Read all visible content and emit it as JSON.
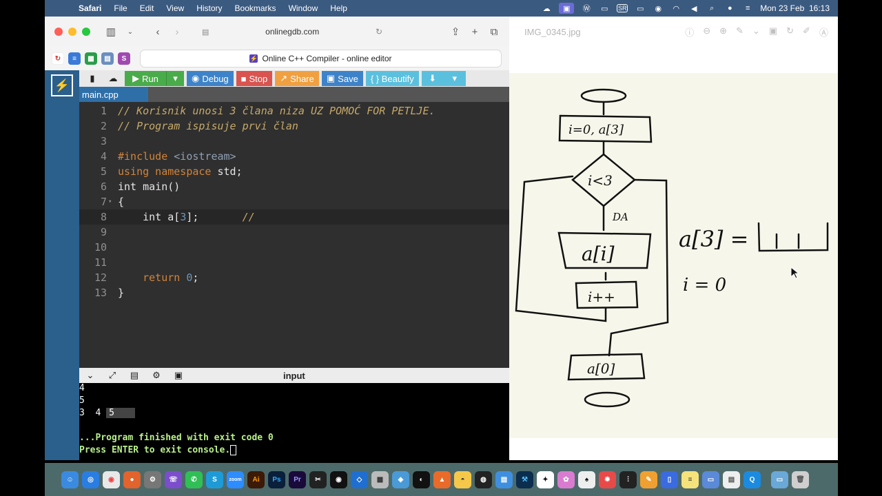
{
  "menubar": {
    "app": "Safari",
    "items": [
      "File",
      "Edit",
      "View",
      "History",
      "Bookmarks",
      "Window",
      "Help"
    ],
    "sr": "SR",
    "clock": "Mon 23 Feb  16:13"
  },
  "safari": {
    "url": "onlinegdb.com",
    "tab_title": "Online C++ Compiler - online editor"
  },
  "toolbar": {
    "run": "Run",
    "debug": "Debug",
    "stop": "Stop",
    "share": "Share",
    "save": "Save",
    "beautify": "{ } Beautify"
  },
  "file_tab": "main.cpp",
  "code_lines": [
    {
      "n": "1",
      "text": "// Korisnik unosi 3 člana niza UZ POMOĆ FOR PETLJE."
    },
    {
      "n": "2",
      "text": "// Program ispisuje prvi član"
    },
    {
      "n": "3",
      "text": ""
    },
    {
      "n": "4",
      "pre": "#include ",
      "inc": "<iostream>"
    },
    {
      "n": "5",
      "kw": "using namespace ",
      "text": "std;"
    },
    {
      "n": "6",
      "text": "int main()"
    },
    {
      "n": "7",
      "text": "{"
    },
    {
      "n": "8",
      "text": "    int a[",
      "num": "3",
      "text2": "];       ",
      "comment": "//"
    },
    {
      "n": "9",
      "text": ""
    },
    {
      "n": "10",
      "text": ""
    },
    {
      "n": "11",
      "text": ""
    },
    {
      "n": "12",
      "kw": "    return ",
      "num": "0",
      "text": ";"
    },
    {
      "n": "13",
      "text": "}"
    }
  ],
  "console": {
    "label": "input",
    "lines": [
      "4",
      "5",
      "3  4 ",
      "5",
      "...Program finished with exit code 0",
      "Press ENTER to exit console."
    ]
  },
  "viewer": {
    "filename": "IMG_0345.jpg",
    "sketch": {
      "init": "i=0, a[3]",
      "cond": "i<3",
      "da": "DA",
      "input": "a[i]",
      "inc": "i++",
      "output": "a[0]",
      "array": "a[3] =",
      "i0": "i = 0"
    }
  },
  "colors": {
    "menubar": "#3b5a80",
    "gdb_side": "#2b5f8c",
    "run": "#4aab4a",
    "debug": "#3e83c9",
    "stop": "#d9534f",
    "share": "#f0a040",
    "beautify": "#5bc0de",
    "console_green": "#b9f08a"
  }
}
